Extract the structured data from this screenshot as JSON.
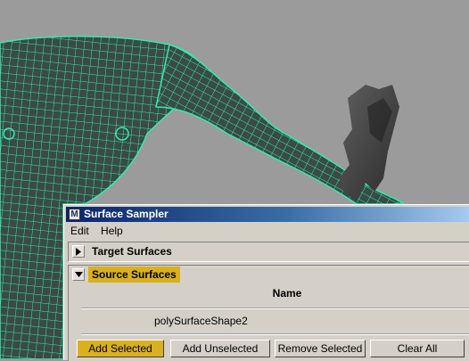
{
  "window": {
    "title": "Surface Sampler",
    "app_icon": "maya-m-icon",
    "app_icon_glyph": "M"
  },
  "menubar": {
    "items": [
      "Edit",
      "Help"
    ]
  },
  "sections": {
    "target": {
      "label": "Target Surfaces",
      "expanded": false
    },
    "source": {
      "label": "Source Surfaces",
      "expanded": true,
      "column_header": "Name",
      "rows": [
        "polySurfaceShape2"
      ]
    }
  },
  "buttons": {
    "add_selected": "Add Selected",
    "add_unselected": "Add Unselected",
    "remove_selected": "Remove Selected",
    "clear_all": "Clear All"
  },
  "colors": {
    "viewport_bg": "#9b9b9b",
    "wireframe": "#38e8b0",
    "highlight": "#d8b020",
    "panel": "#d4d0c8"
  }
}
